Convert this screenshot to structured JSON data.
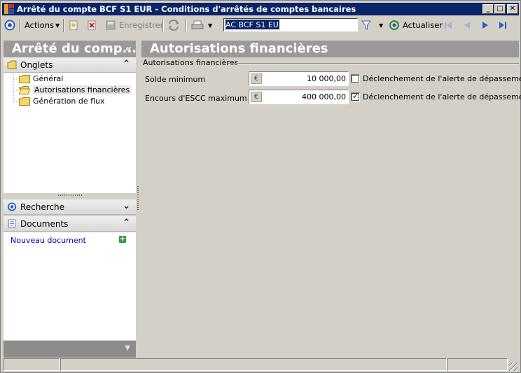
{
  "window": {
    "title": "Arrêté du compte BCF S1 EUR - Conditions d'arrêtés de comptes bancaires",
    "controls": {
      "minimize": "_",
      "maximize": "□",
      "close": "✕"
    }
  },
  "toolbar": {
    "actions_label": "Actions",
    "save_label": "Enregistrer",
    "search_value": "AC BCF S1 EUR",
    "refresh_label": "Actualiser"
  },
  "left_panel": {
    "header_title": "Arrêté du comp...",
    "header_chevron": "«",
    "onglets": {
      "label": "Onglets",
      "chevron": "⌃",
      "items": [
        {
          "label": "Général"
        },
        {
          "label": "Autorisations financières"
        },
        {
          "label": "Génération de flux"
        }
      ]
    },
    "recherche": {
      "label": "Recherche",
      "chevron": "⌄"
    },
    "documents": {
      "label": "Documents",
      "chevron": "⌃",
      "new_doc": "Nouveau document"
    }
  },
  "main": {
    "header_title": "Autorisations financières",
    "group_title": "Autorisations financières",
    "rows": [
      {
        "label": "Solde minimum",
        "currency": "€",
        "value": "10 000,00",
        "alert_label": "Déclenchement de l'alerte de dépassement",
        "checked": false
      },
      {
        "label": "Encours d'ESCC maximum",
        "currency": "€",
        "value": "400 000,00",
        "alert_label": "Déclenchement de l'alerte de dépassement",
        "checked": true
      }
    ]
  },
  "colors": {
    "titlebar": "#0a246a",
    "panel_header": "#9a9a9a",
    "face": "#d4d0c8",
    "link": "#0000c0"
  }
}
